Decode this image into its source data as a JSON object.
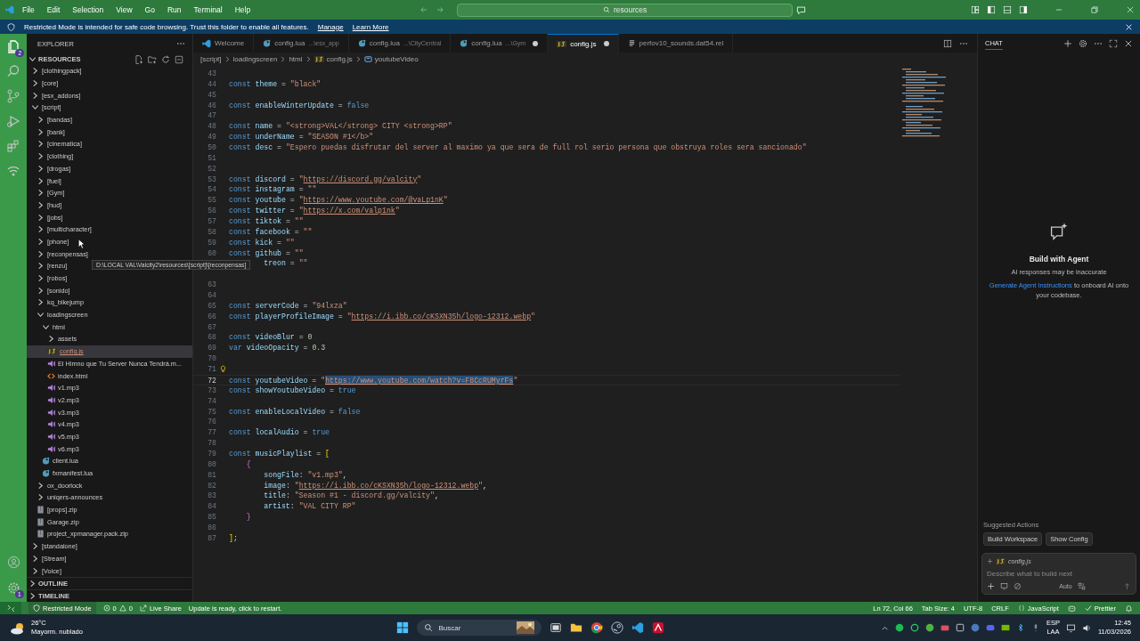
{
  "title_bar": {
    "menu": [
      "File",
      "Edit",
      "Selection",
      "View",
      "Go",
      "Run",
      "Terminal",
      "Help"
    ],
    "search": "resources"
  },
  "banner": {
    "text": "Restricted Mode is intended for safe code browsing. Trust this folder to enable all features.",
    "links": [
      "Manage",
      "Learn More"
    ]
  },
  "activity_bar": {
    "explorer_badge": "2",
    "settings_badge": "1"
  },
  "explorer": {
    "title": "EXPLORER",
    "root": {
      "label": "RESOURCES",
      "expanded": true
    },
    "tree": [
      {
        "label": "[clothingpack]",
        "kind": "folder",
        "expanded": false,
        "selected": false
      },
      {
        "label": "[core]",
        "kind": "folder",
        "expanded": false,
        "selected": false
      },
      {
        "label": "[esx_addons]",
        "kind": "folder",
        "expanded": false,
        "selected": false
      },
      {
        "label": "[script]",
        "kind": "folder",
        "expanded": true,
        "selected": false,
        "children": [
          {
            "label": "[bandas]",
            "kind": "folder",
            "expanded": false,
            "selected": false
          },
          {
            "label": "[bank]",
            "kind": "folder",
            "expanded": false,
            "selected": false
          },
          {
            "label": "[cinematica]",
            "kind": "folder",
            "expanded": false,
            "selected": false
          },
          {
            "label": "[clothing]",
            "kind": "folder",
            "expanded": false,
            "selected": false
          },
          {
            "label": "[drogas]",
            "kind": "folder",
            "expanded": false,
            "selected": false
          },
          {
            "label": "[fuel]",
            "kind": "folder",
            "expanded": false,
            "selected": false
          },
          {
            "label": "[Gym]",
            "kind": "folder",
            "expanded": false,
            "selected": false
          },
          {
            "label": "[hud]",
            "kind": "folder",
            "expanded": false,
            "selected": false
          },
          {
            "label": "[jobs]",
            "kind": "folder",
            "expanded": false,
            "selected": false
          },
          {
            "label": "[multicharacter]",
            "kind": "folder",
            "expanded": false,
            "selected": false
          },
          {
            "label": "[phone]",
            "kind": "folder",
            "expanded": false,
            "selected": false
          },
          {
            "label": "[reconpensas]",
            "kind": "folder",
            "expanded": false,
            "selected": false
          },
          {
            "label": "[renzu]",
            "kind": "folder",
            "expanded": false,
            "selected": false
          },
          {
            "label": "[robos]",
            "kind": "folder",
            "expanded": false,
            "selected": false
          },
          {
            "label": "[sonido]",
            "kind": "folder",
            "expanded": false,
            "selected": false
          },
          {
            "label": "kq_bikejump",
            "kind": "folder",
            "expanded": false,
            "selected": false
          },
          {
            "label": "loadingscreen",
            "kind": "folder",
            "expanded": true,
            "selected": false,
            "children": [
              {
                "label": "html",
                "kind": "folder",
                "expanded": true,
                "selected": false,
                "children": [
                  {
                    "label": "assets",
                    "kind": "folder",
                    "expanded": false,
                    "selected": false
                  },
                  {
                    "label": "config.js",
                    "kind": "js",
                    "selected": true
                  },
                  {
                    "label": "El Himno que Tu Server Nunca Tendrá.m...",
                    "kind": "audio",
                    "selected": false
                  },
                  {
                    "label": "index.html",
                    "kind": "html",
                    "selected": false
                  },
                  {
                    "label": "v1.mp3",
                    "kind": "audio",
                    "selected": false
                  },
                  {
                    "label": "v2.mp3",
                    "kind": "audio",
                    "selected": false
                  },
                  {
                    "label": "v3.mp3",
                    "kind": "audio",
                    "selected": false
                  },
                  {
                    "label": "v4.mp3",
                    "kind": "audio",
                    "selected": false
                  },
                  {
                    "label": "v5.mp3",
                    "kind": "audio",
                    "selected": false
                  },
                  {
                    "label": "v6.mp3",
                    "kind": "audio",
                    "selected": false
                  }
                ]
              },
              {
                "label": "client.lua",
                "kind": "lua",
                "selected": false
              },
              {
                "label": "fxmanifest.lua",
                "kind": "lua",
                "selected": false
              }
            ]
          },
          {
            "label": "ox_doorlock",
            "kind": "folder",
            "expanded": false,
            "selected": false
          },
          {
            "label": "uniqers-announces",
            "kind": "folder",
            "expanded": false,
            "selected": false
          },
          {
            "label": "[props].zip",
            "kind": "zip",
            "selected": false
          },
          {
            "label": "Garage.zip",
            "kind": "zip",
            "selected": false
          },
          {
            "label": "project_xpmanager.pack.zip",
            "kind": "zip",
            "selected": false
          }
        ]
      },
      {
        "label": "[standalone]",
        "kind": "folder",
        "expanded": false,
        "selected": false
      },
      {
        "label": "[Stream]",
        "kind": "folder",
        "expanded": false,
        "selected": false
      },
      {
        "label": "[Voice]",
        "kind": "folder",
        "expanded": false,
        "selected": false
      }
    ],
    "sections": [
      {
        "label": "OUTLINE",
        "expanded": false
      },
      {
        "label": "TIMELINE",
        "expanded": false
      }
    ],
    "tooltip": "D:\\LOCAL VAL\\Valcity2\\resources\\[script]\\[reconpensas]"
  },
  "tabs": [
    {
      "label": "Welcome",
      "kind": "vscode",
      "modified": false,
      "selected": false
    },
    {
      "label": "config.lua",
      "path": "...\\esx_app",
      "kind": "lua",
      "modified": false,
      "selected": false
    },
    {
      "label": "config.lua",
      "path": "...\\CityCentral",
      "kind": "lua",
      "modified": false,
      "selected": false
    },
    {
      "label": "config.lua",
      "path": "...\\Gym",
      "kind": "lua",
      "modified": true,
      "selected": false
    },
    {
      "label": "config.js",
      "kind": "js",
      "modified": true,
      "selected": true
    },
    {
      "label": "perfov10_sounds.dat54.rel",
      "kind": "file",
      "modified": false,
      "selected": false
    }
  ],
  "breadcrumb": [
    {
      "label": "[script]",
      "kind": "folder"
    },
    {
      "label": "loadingscreen",
      "kind": "folder"
    },
    {
      "label": "html",
      "kind": "folder"
    },
    {
      "label": "config.js",
      "kind": "js"
    },
    {
      "label": "youtubeVideo",
      "kind": "symbol"
    }
  ],
  "code": [
    {
      "n": "43"
    },
    {
      "n": "44",
      "t": [
        {
          "kind": "kw",
          "s": "const "
        },
        {
          "kind": "id",
          "s": "theme"
        },
        {
          "kind": "op",
          "s": " = "
        },
        {
          "kind": "str",
          "s": "\"black\""
        }
      ]
    },
    {
      "n": "45"
    },
    {
      "n": "46",
      "t": [
        {
          "kind": "kw",
          "s": "const "
        },
        {
          "kind": "id",
          "s": "enableWinterUpdate"
        },
        {
          "kind": "op",
          "s": " = "
        },
        {
          "kind": "kw",
          "s": "false"
        }
      ]
    },
    {
      "n": "47"
    },
    {
      "n": "48",
      "t": [
        {
          "kind": "kw",
          "s": "const "
        },
        {
          "kind": "id",
          "s": "name"
        },
        {
          "kind": "op",
          "s": " = "
        },
        {
          "kind": "str",
          "s": "\"<strong>VAL</strong> CITY <strong>RP\""
        }
      ]
    },
    {
      "n": "49",
      "t": [
        {
          "kind": "kw",
          "s": "const "
        },
        {
          "kind": "id",
          "s": "underName"
        },
        {
          "kind": "op",
          "s": " = "
        },
        {
          "kind": "str",
          "s": "\"SEASON #1</b>\""
        }
      ]
    },
    {
      "n": "50",
      "t": [
        {
          "kind": "kw",
          "s": "const "
        },
        {
          "kind": "id",
          "s": "desc"
        },
        {
          "kind": "op",
          "s": " = "
        },
        {
          "kind": "str",
          "s": "\"Espero puedas disfrutar del server al maximo ya que sera de full rol serio persona que obstruya roles sera sancionado\""
        }
      ]
    },
    {
      "n": "51"
    },
    {
      "n": "52"
    },
    {
      "n": "53",
      "t": [
        {
          "kind": "kw",
          "s": "const "
        },
        {
          "kind": "id",
          "s": "discord"
        },
        {
          "kind": "op",
          "s": " = "
        },
        {
          "kind": "str",
          "s": "\""
        },
        {
          "kind": "url",
          "s": "https://discord.gg/valcity"
        },
        {
          "kind": "str",
          "s": "\""
        }
      ]
    },
    {
      "n": "54",
      "t": [
        {
          "kind": "kw",
          "s": "const "
        },
        {
          "kind": "id",
          "s": "instagram"
        },
        {
          "kind": "op",
          "s": " = "
        },
        {
          "kind": "str",
          "s": "\"\""
        }
      ]
    },
    {
      "n": "55",
      "t": [
        {
          "kind": "kw",
          "s": "const "
        },
        {
          "kind": "id",
          "s": "youtube"
        },
        {
          "kind": "op",
          "s": " = "
        },
        {
          "kind": "str",
          "s": "\""
        },
        {
          "kind": "url",
          "s": "https://www.youtube.com/@vaLp1nK"
        },
        {
          "kind": "str",
          "s": "\""
        }
      ]
    },
    {
      "n": "56",
      "t": [
        {
          "kind": "kw",
          "s": "const "
        },
        {
          "kind": "id",
          "s": "twitter"
        },
        {
          "kind": "op",
          "s": " = "
        },
        {
          "kind": "str",
          "s": "\""
        },
        {
          "kind": "url",
          "s": "https://x.com/valp1nk"
        },
        {
          "kind": "str",
          "s": "\""
        }
      ]
    },
    {
      "n": "57",
      "t": [
        {
          "kind": "kw",
          "s": "const "
        },
        {
          "kind": "id",
          "s": "tiktok"
        },
        {
          "kind": "op",
          "s": " = "
        },
        {
          "kind": "str",
          "s": "\"\""
        }
      ]
    },
    {
      "n": "58",
      "t": [
        {
          "kind": "kw",
          "s": "const "
        },
        {
          "kind": "id",
          "s": "facebook"
        },
        {
          "kind": "op",
          "s": " = "
        },
        {
          "kind": "str",
          "s": "\"\""
        }
      ]
    },
    {
      "n": "59",
      "t": [
        {
          "kind": "kw",
          "s": "const "
        },
        {
          "kind": "id",
          "s": "kick"
        },
        {
          "kind": "op",
          "s": " = "
        },
        {
          "kind": "str",
          "s": "\"\""
        }
      ]
    },
    {
      "n": "60",
      "t": [
        {
          "kind": "kw",
          "s": "const "
        },
        {
          "kind": "id",
          "s": "github"
        },
        {
          "kind": "op",
          "s": " = "
        },
        {
          "kind": "str",
          "s": "\"\""
        }
      ]
    },
    {
      "cut": true,
      "t": [
        {
          "kind": "id",
          "s": "treon"
        },
        {
          "kind": "op",
          "s": " = "
        },
        {
          "kind": "str",
          "s": "\"\""
        }
      ]
    },
    {
      "cut": true
    },
    {
      "n": "63"
    },
    {
      "n": "64"
    },
    {
      "n": "65",
      "t": [
        {
          "kind": "kw",
          "s": "const "
        },
        {
          "kind": "id",
          "s": "serverCode"
        },
        {
          "kind": "op",
          "s": " = "
        },
        {
          "kind": "str",
          "s": "\"94lxza\""
        }
      ]
    },
    {
      "n": "66",
      "t": [
        {
          "kind": "kw",
          "s": "const "
        },
        {
          "kind": "id",
          "s": "playerProfileImage"
        },
        {
          "kind": "op",
          "s": " = "
        },
        {
          "kind": "str",
          "s": "\""
        },
        {
          "kind": "url",
          "s": "https://i.ibb.co/cKSXN35h/logo-12312.webp"
        },
        {
          "kind": "str",
          "s": "\""
        }
      ]
    },
    {
      "n": "67"
    },
    {
      "n": "68",
      "t": [
        {
          "kind": "kw",
          "s": "const "
        },
        {
          "kind": "id",
          "s": "videoBlur"
        },
        {
          "kind": "op",
          "s": " = "
        },
        {
          "kind": "num",
          "s": "0"
        }
      ]
    },
    {
      "n": "69",
      "t": [
        {
          "kind": "kw",
          "s": "var "
        },
        {
          "kind": "id",
          "s": "videoOpacity"
        },
        {
          "kind": "op",
          "s": " = "
        },
        {
          "kind": "num",
          "s": "0.3"
        }
      ]
    },
    {
      "n": "70"
    },
    {
      "n": "71",
      "lightbulb": true
    },
    {
      "n": "72",
      "selected": true,
      "t": [
        {
          "kind": "kw",
          "s": "const "
        },
        {
          "kind": "id",
          "s": "youtubeVideo"
        },
        {
          "kind": "op",
          "s": " = "
        },
        {
          "kind": "str",
          "s": "\""
        },
        {
          "kind": "sel",
          "s": "https://www.youtube.com/watch?v=F8CcRUMyrFs"
        },
        {
          "kind": "str",
          "s": "\""
        }
      ]
    },
    {
      "n": "73",
      "t": [
        {
          "kind": "kw",
          "s": "const "
        },
        {
          "kind": "id",
          "s": "showYoutubeVideo"
        },
        {
          "kind": "op",
          "s": " = "
        },
        {
          "kind": "kw",
          "s": "true"
        }
      ]
    },
    {
      "n": "74"
    },
    {
      "n": "75",
      "t": [
        {
          "kind": "kw",
          "s": "const "
        },
        {
          "kind": "id",
          "s": "enableLocalVideo"
        },
        {
          "kind": "op",
          "s": " = "
        },
        {
          "kind": "kw",
          "s": "false"
        }
      ]
    },
    {
      "n": "76"
    },
    {
      "n": "77",
      "t": [
        {
          "kind": "kw",
          "s": "const "
        },
        {
          "kind": "id",
          "s": "localAudio"
        },
        {
          "kind": "op",
          "s": " = "
        },
        {
          "kind": "kw",
          "s": "true"
        }
      ]
    },
    {
      "n": "78"
    },
    {
      "n": "79",
      "t": [
        {
          "kind": "kw",
          "s": "const "
        },
        {
          "kind": "id",
          "s": "musicPlaylist"
        },
        {
          "kind": "op",
          "s": " = "
        },
        {
          "kind": "br1",
          "s": "["
        }
      ]
    },
    {
      "n": "80",
      "t": [
        {
          "kind": "br2",
          "s": "    {"
        }
      ]
    },
    {
      "n": "81",
      "t": [
        {
          "kind": "id",
          "s": "        songFile"
        },
        {
          "kind": "op",
          "s": ": "
        },
        {
          "kind": "str",
          "s": "\"v1.mp3\""
        },
        {
          "kind": "op",
          "s": ","
        }
      ]
    },
    {
      "n": "82",
      "t": [
        {
          "kind": "id",
          "s": "        image"
        },
        {
          "kind": "op",
          "s": ": "
        },
        {
          "kind": "str",
          "s": "\""
        },
        {
          "kind": "url",
          "s": "https://i.ibb.co/cKSXN35h/logo-12312.webp"
        },
        {
          "kind": "str",
          "s": "\""
        },
        {
          "kind": "op",
          "s": ","
        }
      ]
    },
    {
      "n": "83",
      "t": [
        {
          "kind": "id",
          "s": "        title"
        },
        {
          "kind": "op",
          "s": ": "
        },
        {
          "kind": "str",
          "s": "\"Season #1 - discord.gg/valcity\""
        },
        {
          "kind": "op",
          "s": ","
        }
      ]
    },
    {
      "n": "84",
      "t": [
        {
          "kind": "id",
          "s": "        artist"
        },
        {
          "kind": "op",
          "s": ": "
        },
        {
          "kind": "str",
          "s": "\"VAL CITY RP\""
        }
      ]
    },
    {
      "n": "85",
      "t": [
        {
          "kind": "br2",
          "s": "    }"
        }
      ]
    },
    {
      "n": "86"
    },
    {
      "n": "87",
      "t": [
        {
          "kind": "br1",
          "s": "]"
        },
        {
          "kind": "op",
          "s": ";"
        }
      ]
    }
  ],
  "chat": {
    "title": "CHAT",
    "heading": "Build with Agent",
    "note": "AI responses may be inaccurate",
    "link": "Generate Agent Instructions",
    "after_link": "to onboard AI onto your codebase.",
    "suggested_title": "Suggested Actions",
    "suggestions": [
      "Build Workspace",
      "Show Config"
    ],
    "context_file": "config.js",
    "placeholder": "Describe what to build next",
    "mode": "Auto"
  },
  "status_bar": {
    "restricted": "Restricted Mode",
    "errors": "0",
    "warnings": "0",
    "live_share": "Live Share",
    "update": "Update is ready, click to restart.",
    "position": "Ln 72, Col 66",
    "tab_size": "Tab Size: 4",
    "encoding": "UTF-8",
    "eol": "CRLF",
    "language": "JavaScript",
    "formatter": "Prettier"
  },
  "taskbar": {
    "temperature": "26°C",
    "weather": "Mayorm. nublado",
    "search": "Buscar",
    "lang": "ESP",
    "layout": "LAA",
    "time": "12:45",
    "date": "11/03/2026"
  }
}
